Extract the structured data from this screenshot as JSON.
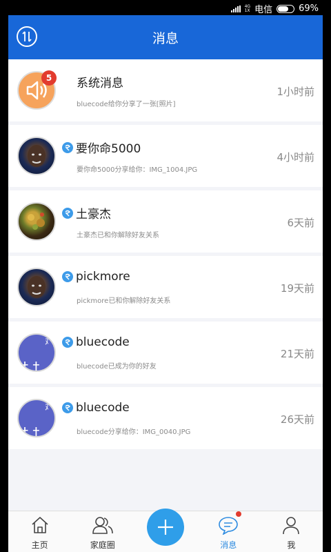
{
  "status_bar": {
    "carrier": "电信",
    "battery": "69%",
    "network": "4G",
    "network_sub": "1X",
    "battery_level": 0.69
  },
  "header": {
    "title": "消息",
    "left_icon": "swap-icon"
  },
  "messages": [
    {
      "name": "系统消息",
      "preview": "bluecode给你分享了一张[照片]",
      "time": "1小时前",
      "badge": "5",
      "avatar": "speaker-icon",
      "verified": false
    },
    {
      "name": "要你命5000",
      "preview": "要你命5000分享给你：IMG_1004.JPG",
      "time": "4小时前",
      "avatar": "face-photo",
      "verified": true
    },
    {
      "name": "土豪杰",
      "preview": "土豪杰已和你解除好友关系",
      "time": "6天前",
      "avatar": "food-photo",
      "verified": true
    },
    {
      "name": "pickmore",
      "preview": "pickmore已和你解除好友关系",
      "time": "19天前",
      "avatar": "face-photo",
      "verified": true
    },
    {
      "name": "bluecode",
      "preview": "bluecode已成为你的好友",
      "time": "21天前",
      "avatar": "purple-default",
      "verified": true
    },
    {
      "name": "bluecode",
      "preview": "bluecode分享给你：IMG_0040.JPG",
      "time": "26天前",
      "avatar": "purple-default",
      "verified": true
    }
  ],
  "nav": {
    "home": "主页",
    "family": "家庭圈",
    "messages": "消息",
    "me": "我",
    "active": "messages"
  },
  "colors": {
    "primary": "#1867d8",
    "accent": "#2f9ee9",
    "badge": "#e23b2e"
  }
}
